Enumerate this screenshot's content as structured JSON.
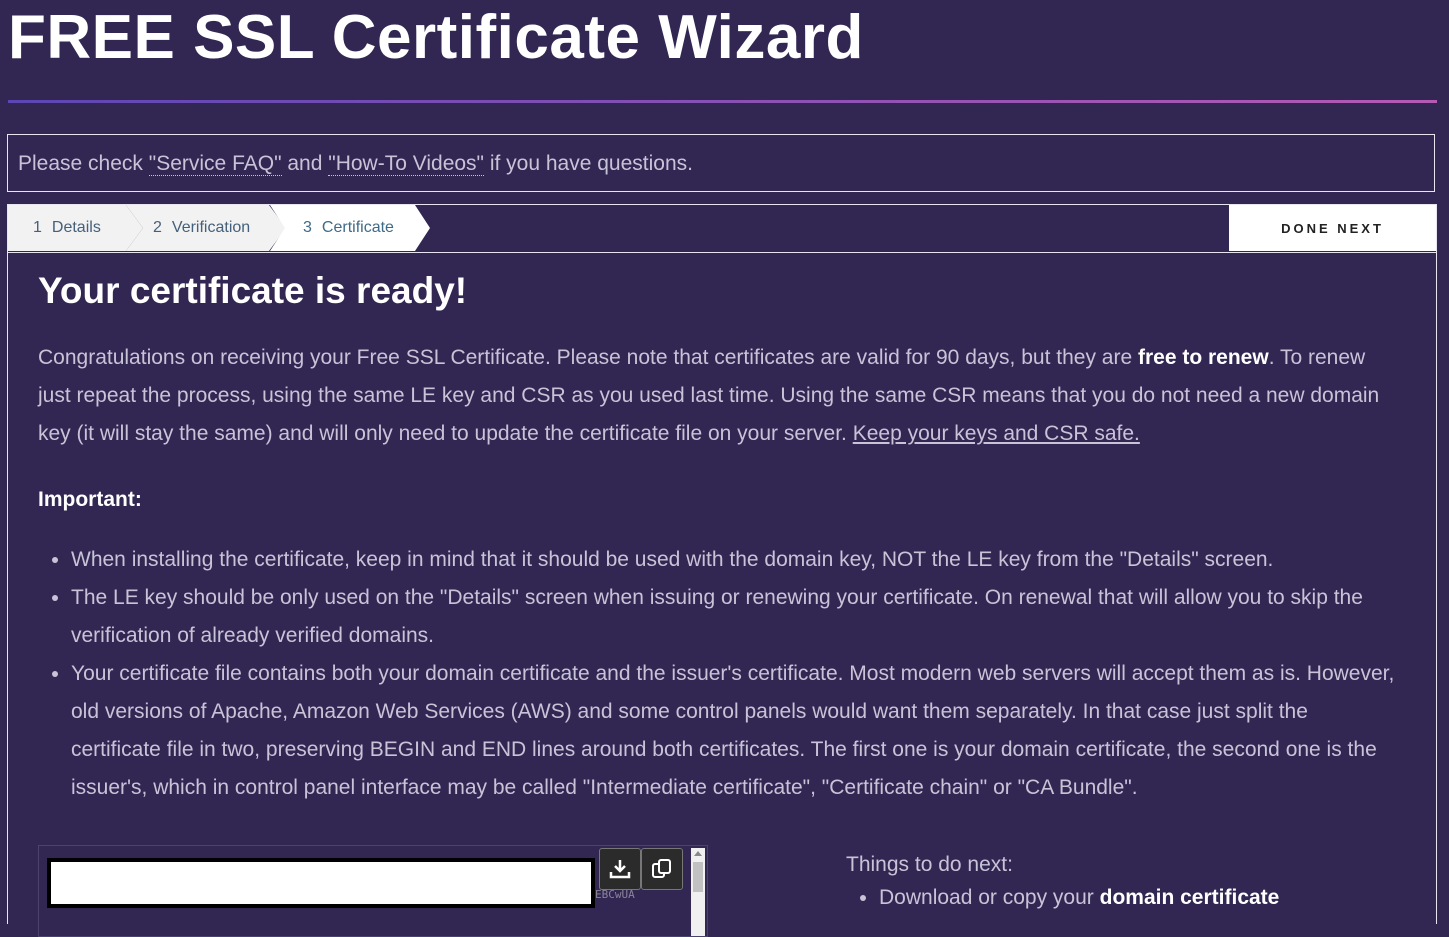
{
  "page": {
    "title": "FREE SSL Certificate Wizard"
  },
  "notice": {
    "prefix": "Please check ",
    "faq_link": "\"Service FAQ\"",
    "middle": " and ",
    "videos_link": "\"How-To Videos\"",
    "suffix": " if you have questions."
  },
  "steps": [
    {
      "num": "1",
      "label": "Details"
    },
    {
      "num": "2",
      "label": "Verification"
    },
    {
      "num": "3",
      "label": "Certificate"
    }
  ],
  "done_next_label": "DONE NEXT",
  "content": {
    "heading": "Your certificate is ready!",
    "lead_part1": "Congratulations on receiving your Free SSL Certificate. Please note that certificates are valid for 90 days, but they are ",
    "lead_bold": "free to renew",
    "lead_part2": ". To renew just repeat the process, using the same LE key and CSR as you used last time. Using the same CSR means that you do not need a new domain key (it will stay the same) and will only need to update the certificate file on your server. ",
    "lead_link": "Keep your keys and CSR safe.",
    "important_label": "Important:",
    "notes": [
      "When installing the certificate, keep in mind that it should be used with the domain key, NOT the LE key from the \"Details\" screen.",
      "The LE key should be only used on the \"Details\" screen when issuing or renewing your certificate. On renewal that will allow you to skip the verification of already verified domains.",
      "Your certificate file contains both your domain certificate and the issuer's certificate. Most modern web servers will accept them as is. However, old versions of Apache, Amazon Web Services (AWS) and some control panels would want them separately. In that case just split the certificate file in two, preserving BEGIN and END lines around both certificates. The first one is your domain certificate, the second one is the issuer's, which in control panel interface may be called \"Intermediate certificate\", \"Certificate chain\" or \"CA Bundle\"."
    ]
  },
  "cert_box": {
    "ghost_text": "EBCwUA",
    "download_icon": "download-icon",
    "copy_icon": "copy-icon"
  },
  "next_steps": {
    "title": "Things to do next:",
    "item1_prefix": "Download or copy your ",
    "item1_bold": "domain certificate"
  }
}
